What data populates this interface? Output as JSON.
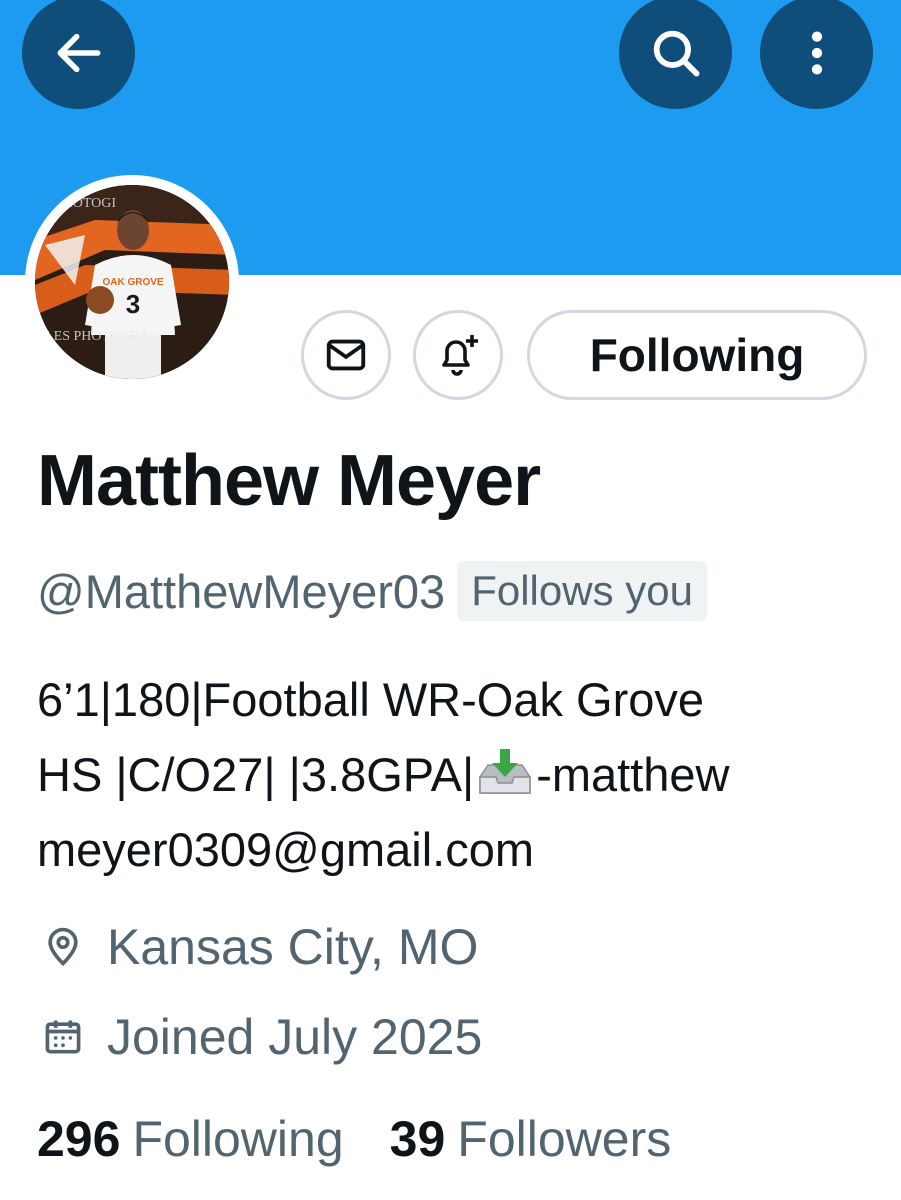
{
  "header": {
    "back_icon": "arrow-left-icon",
    "search_icon": "search-icon",
    "more_icon": "more-vertical-icon",
    "banner_color": "#1d9bf0",
    "button_color": "#0f4e7a"
  },
  "avatar": {
    "jersey_number": "3",
    "jersey_text": "OAK GROVE",
    "watermark_top": "ES PHOTOGI",
    "watermark_bottom": "ALES PHOTOGRA"
  },
  "actions": {
    "message_icon": "envelope-icon",
    "notify_icon": "bell-plus-icon",
    "follow_label": "Following"
  },
  "profile": {
    "name": "Matthew Meyer",
    "handle": "@MatthewMeyer03",
    "follows_you": "Follows you",
    "bio_line1": "6’1|180|Football WR-Oak Grove",
    "bio_line2a": "HS |C/O27| |3.8GPA|",
    "bio_line2b": "-matthew",
    "bio_line3": "meyer0309@gmail.com",
    "bio_emoji": "inbox-tray-icon",
    "location": "Kansas City, MO",
    "location_icon": "location-pin-icon",
    "joined": "Joined July 2025",
    "joined_icon": "calendar-icon"
  },
  "stats": {
    "following_count": "296",
    "following_label": "Following",
    "followers_count": "39",
    "followers_label": "Followers"
  }
}
